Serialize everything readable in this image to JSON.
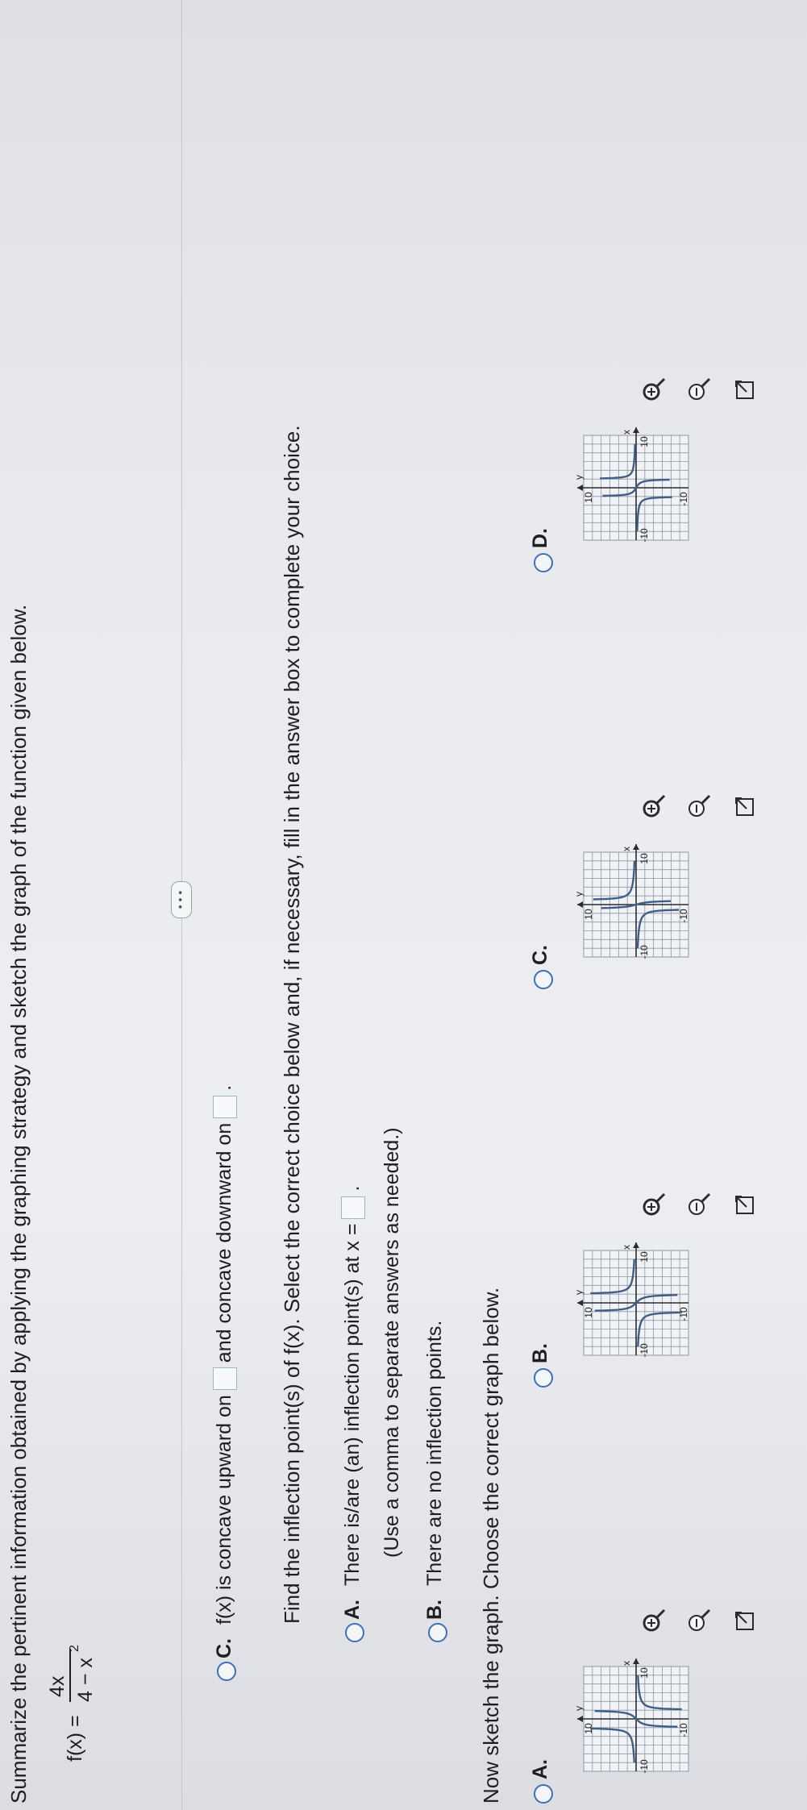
{
  "header": {
    "instruction": "Summarize the pertinent information obtained by applying the graphing strategy and sketch the graph of the function given below."
  },
  "function": {
    "lhs": "f(x) =",
    "numerator": "4x",
    "denominator": "4 − x",
    "exponent": "2"
  },
  "more_button": "• • •",
  "concavity": {
    "letter": "C.",
    "text_before": "f(x) is concave upward on",
    "text_middle": "and concave downward on",
    "text_after": "."
  },
  "inflection": {
    "prompt": "Find the inflection point(s) of f(x). Select the correct choice below and, if necessary, fill in the answer box to complete your choice.",
    "option_a_letter": "A.",
    "option_a_text": "There is/are (an) inflection point(s) at x =",
    "option_a_after": ".",
    "option_a_hint": "(Use a comma to separate answers as needed.)",
    "option_b_letter": "B.",
    "option_b_text": "There are no inflection points."
  },
  "sketch": {
    "prompt": "Now sketch the graph. Choose the correct graph below.",
    "options": [
      {
        "letter": "A.",
        "x_label": "x",
        "y_label": "y",
        "tick_neg": "-10",
        "tick_pos": "10",
        "y_tick_pos": "10",
        "y_tick_neg": "-10"
      },
      {
        "letter": "B.",
        "x_label": "x",
        "y_label": "y",
        "tick_neg": "-10",
        "tick_pos": "10",
        "y_tick_pos": "10",
        "y_tick_neg": "-10"
      },
      {
        "letter": "C.",
        "x_label": "x",
        "y_label": "y",
        "tick_neg": "-10",
        "tick_pos": "10",
        "y_tick_pos": "10",
        "y_tick_neg": "-10"
      },
      {
        "letter": "D.",
        "x_label": "x",
        "y_label": "y",
        "tick_neg": "-10",
        "tick_pos": "10",
        "y_tick_pos": "10",
        "y_tick_neg": "-10"
      }
    ]
  },
  "colors": {
    "radio": "#3d6fb8",
    "curve": "#3f5f86",
    "grid": "#9096a0",
    "text": "#1d1d22"
  },
  "icons": [
    "zoom-in-icon",
    "zoom-out-icon",
    "expand-icon"
  ]
}
